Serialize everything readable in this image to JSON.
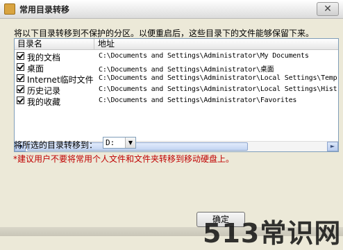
{
  "window": {
    "title": "常用目录转移",
    "close_glyph": "✕"
  },
  "instruction": "将以下目录转移到不保护的分区。以便重启后，这些目录下的文件能够保留下来。",
  "list": {
    "columns": [
      "目录名",
      "地址"
    ],
    "rows": [
      {
        "name": "我的文档",
        "path": "C:\\Documents and Settings\\Administrator\\My Documents",
        "checked": true
      },
      {
        "name": "桌面",
        "path": "C:\\Documents and Settings\\Administrator\\桌面",
        "checked": true
      },
      {
        "name": "Internet临时文件",
        "path": "C:\\Documents and Settings\\Administrator\\Local Settings\\Temp",
        "checked": true
      },
      {
        "name": "历史记录",
        "path": "C:\\Documents and Settings\\Administrator\\Local Settings\\Hist",
        "checked": true
      },
      {
        "name": "我的收藏",
        "path": "C:\\Documents and Settings\\Administrator\\Favorites",
        "checked": true
      }
    ],
    "scroll_left_glyph": "◄",
    "scroll_right_glyph": "►"
  },
  "destination": {
    "label": "将所选的目录转移到：",
    "value": "D:",
    "arrow_glyph": "▼"
  },
  "warning": "*建议用户不要将常用个人文件和文件夹转移到移动硬盘上。",
  "ok_button": "确定",
  "watermark": "513常识网"
}
